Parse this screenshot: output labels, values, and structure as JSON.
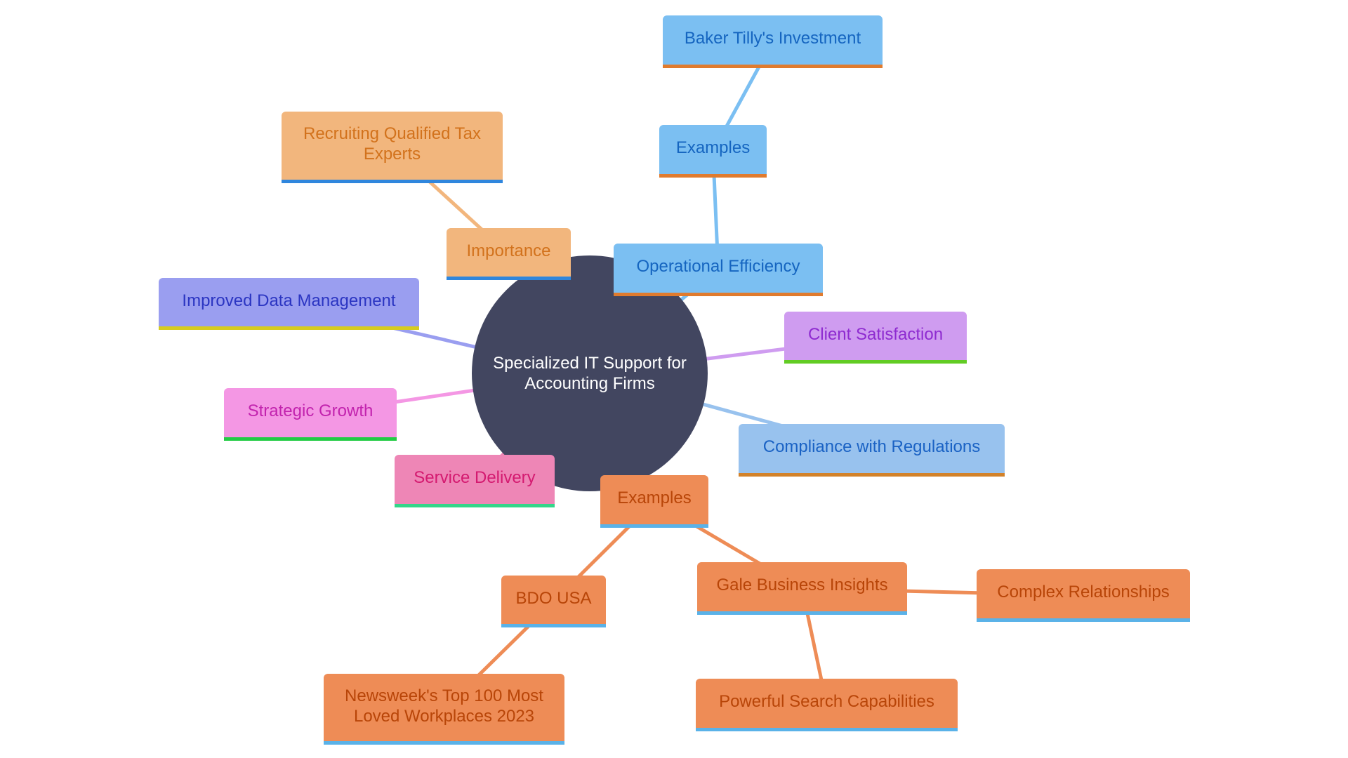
{
  "diagram": {
    "type": "mindmap",
    "root": {
      "id": "root",
      "label": "Specialized IT Support for Accounting Firms",
      "fill": "#424660",
      "text_color": "#ffffff"
    },
    "nodes": [
      {
        "id": "baker-tilly",
        "label": "Baker Tilly's Investment",
        "parent": "examples-blue",
        "fill": "#7BBFF2",
        "text_color": "#1565C0",
        "accent": "#E07B2E",
        "line": "#7BBFF2"
      },
      {
        "id": "examples-blue",
        "label": "Examples",
        "parent": "operational-efficiency",
        "fill": "#7BBFF2",
        "text_color": "#1565C0",
        "accent": "#E07B2E",
        "line": "#7BBFF2"
      },
      {
        "id": "recruiting",
        "label": "Recruiting Qualified Tax Experts",
        "parent": "importance",
        "fill": "#F2B67D",
        "text_color": "#D2721C",
        "accent": "#2F86DD",
        "line": "#F2B67D"
      },
      {
        "id": "importance",
        "label": "Importance",
        "parent": "root",
        "fill": "#F2B67D",
        "text_color": "#D2721C",
        "accent": "#2F86DD",
        "line": "#F2B67D"
      },
      {
        "id": "operational-efficiency",
        "label": "Operational Efficiency",
        "parent": "root",
        "fill": "#7BBFF2",
        "text_color": "#1565C0",
        "accent": "#E07B2E",
        "line": "#7BBFF2"
      },
      {
        "id": "improved-data",
        "label": "Improved Data Management",
        "parent": "root",
        "fill": "#9A9EF0",
        "text_color": "#2B35C2",
        "accent": "#D6CC1E",
        "line": "#9A9EF0"
      },
      {
        "id": "client-satisfaction",
        "label": "Client Satisfaction",
        "parent": "root",
        "fill": "#CF9CF0",
        "text_color": "#8E2BD0",
        "accent": "#62CC24",
        "line": "#CF9CF0"
      },
      {
        "id": "strategic-growth",
        "label": "Strategic Growth",
        "parent": "root",
        "fill": "#F497E4",
        "text_color": "#C223AE",
        "accent": "#22CC44",
        "line": "#F497E4"
      },
      {
        "id": "compliance",
        "label": "Compliance with Regulations",
        "parent": "root",
        "fill": "#98C2EE",
        "text_color": "#1A62C4",
        "accent": "#D2822A",
        "line": "#98C2EE"
      },
      {
        "id": "service-delivery",
        "label": "Service Delivery",
        "parent": "root",
        "fill": "#EE86B6",
        "text_color": "#D41A70",
        "accent": "#34D68A",
        "line": "#EE86B6"
      },
      {
        "id": "examples-orange",
        "label": "Examples",
        "parent": "root",
        "fill": "#EE8C56",
        "text_color": "#B84508",
        "accent": "#5AB2E8",
        "line": "#EE8C56"
      },
      {
        "id": "bdo-usa",
        "label": "BDO USA",
        "parent": "examples-orange",
        "fill": "#EE8C56",
        "text_color": "#B84508",
        "accent": "#5AB2E8",
        "line": "#EE8C56"
      },
      {
        "id": "gale",
        "label": "Gale Business Insights",
        "parent": "examples-orange",
        "fill": "#EE8C56",
        "text_color": "#B84508",
        "accent": "#5AB2E8",
        "line": "#EE8C56"
      },
      {
        "id": "complex-relationships",
        "label": "Complex Relationships",
        "parent": "gale",
        "fill": "#EE8C56",
        "text_color": "#B84508",
        "accent": "#5AB2E8",
        "line": "#EE8C56"
      },
      {
        "id": "newsweek",
        "label": "Newsweek's Top 100 Most Loved Workplaces 2023",
        "parent": "bdo-usa",
        "fill": "#EE8C56",
        "text_color": "#B84508",
        "accent": "#5AB2E8",
        "line": "#EE8C56"
      },
      {
        "id": "powerful-search",
        "label": "Powerful Search Capabilities",
        "parent": "gale",
        "fill": "#EE8C56",
        "text_color": "#B84508",
        "accent": "#5AB2E8",
        "line": "#EE8C56"
      }
    ]
  }
}
